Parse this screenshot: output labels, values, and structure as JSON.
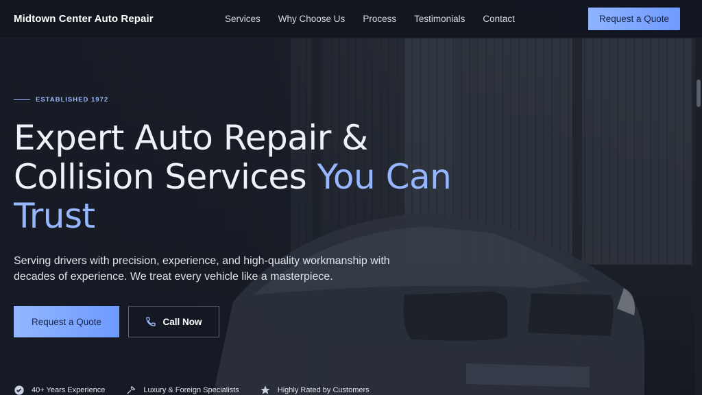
{
  "header": {
    "brand": "Midtown Center Auto Repair",
    "nav": [
      "Services",
      "Why Choose Us",
      "Process",
      "Testimonials",
      "Contact"
    ],
    "cta_label": "Request a Quote"
  },
  "hero": {
    "eyebrow": "ESTABLISHED 1972",
    "headline_part1": "Expert Auto Repair & Collision Services ",
    "headline_accent": "You Can Trust",
    "subtext": "Serving drivers with precision, experience, and high-quality workmanship with decades of experience. We treat every vehicle like a masterpiece.",
    "primary_cta": "Request a Quote",
    "secondary_cta": "Call Now"
  },
  "features": [
    {
      "icon": "badge-check-icon",
      "label": "40+ Years Experience"
    },
    {
      "icon": "tools-icon",
      "label": "Luxury & Foreign Specialists"
    },
    {
      "icon": "star-icon",
      "label": "Highly Rated by Customers"
    }
  ],
  "colors": {
    "accent": "#96b6ff",
    "background": "#131722"
  }
}
